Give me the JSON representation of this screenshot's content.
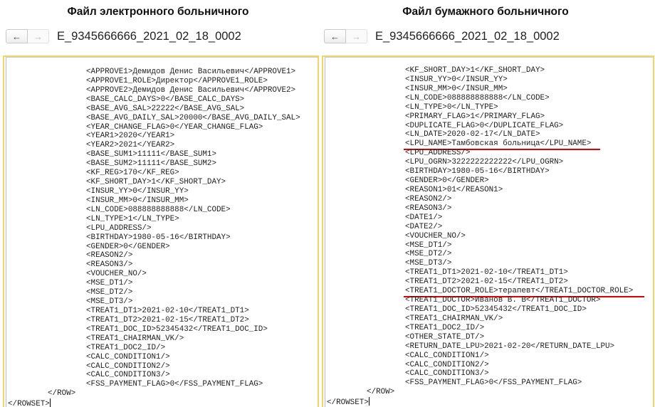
{
  "left": {
    "title": "Файл электронного больничного",
    "filename": "E_9345666666_2021_02_18_0002",
    "lines": [
      "<APPROVE1>Демидов Денис Васильевич</APPROVE1>",
      "<APPROVE1_ROLE>Директор</APPROVE1_ROLE>",
      "<APPROVE2>Демидов Денис Васильевич</APPROVE2>",
      "<BASE_CALC_DAYS>0</BASE_CALC_DAYS>",
      "<BASE_AVG_SAL>22222</BASE_AVG_SAL>",
      "<BASE_AVG_DAILY_SAL>20000</BASE_AVG_DAILY_SAL>",
      "<YEAR_CHANGE_FLAG>0</YEAR_CHANGE_FLAG>",
      "<YEAR1>2020</YEAR1>",
      "<YEAR2>2021</YEAR2>",
      "<BASE_SUM1>11111</BASE_SUM1>",
      "<BASE_SUM2>11111</BASE_SUM2>",
      "<KF_REG>170</KF_REG>",
      "<KF_SHORT_DAY>1</KF_SHORT_DAY>",
      "<INSUR_YY>0</INSUR_YY>",
      "<INSUR_MM>0</INSUR_MM>",
      "<LN_CODE>088888888888</LN_CODE>",
      "<LN_TYPE>1</LN_TYPE>",
      "<LPU_ADDRESS/>",
      "<BIRTHDAY>1980-05-16</BIRTHDAY>",
      "<GENDER>0</GENDER>",
      "<REASON2/>",
      "<REASON3/>",
      "<VOUCHER_NO/>",
      "<MSE_DT1/>",
      "<MSE_DT2/>",
      "<MSE_DT3/>",
      "<TREAT1_DT1>2021-02-10</TREAT1_DT1>",
      "<TREAT1_DT2>2021-02-15</TREAT1_DT2>",
      "<TREAT1_DOC_ID>52345432</TREAT1_DOC_ID>",
      "<TREAT1_CHAIRMAN_VK/>",
      "<TREAT1_DOC2_ID/>",
      "<CALC_CONDITION1/>",
      "<CALC_CONDITION2/>",
      "<CALC_CONDITION3/>",
      "<FSS_PAYMENT_FLAG>0</FSS_PAYMENT_FLAG>"
    ],
    "row_close": "</ROW>",
    "rowset_close": "</ROWSET>"
  },
  "right": {
    "title": "Файл бумажного больничного",
    "filename": "E_9345666666_2021_02_18_0002",
    "lines": [
      "<KF_SHORT_DAY>1</KF_SHORT_DAY>",
      "<INSUR_YY>0</INSUR_YY>",
      "<INSUR_MM>0</INSUR_MM>",
      "<LN_CODE>088888888888</LN_CODE>",
      "<LN_TYPE>0</LN_TYPE>",
      "<PRIMARY_FLAG>1</PRIMARY_FLAG>",
      "<DUPLICATE_FLAG>0</DUPLICATE_FLAG>",
      "<LN_DATE>2020-02-17</LN_DATE>",
      "<LPU_NAME>Тамбовская больница</LPU_NAME>",
      "<LPU_ADDRESS/>",
      "<LPU_OGRN>3222222222222</LPU_OGRN>",
      "<BIRTHDAY>1980-05-16</BIRTHDAY>",
      "<GENDER>0</GENDER>",
      "<REASON1>01</REASON1>",
      "<REASON2/>",
      "<REASON3/>",
      "<DATE1/>",
      "<DATE2/>",
      "<VOUCHER_NO/>",
      "<MSE_DT1/>",
      "<MSE_DT2/>",
      "<MSE_DT3/>",
      "<TREAT1_DT1>2021-02-10</TREAT1_DT1>",
      "<TREAT1_DT2>2021-02-15</TREAT1_DT2>",
      "<TREAT1_DOCTOR_ROLE>терапевт</TREAT1_DOCTOR_ROLE>",
      "<TREAT1_DOCTOR>Иванов В. В</TREAT1_DOCTOR>",
      "<TREAT1_DOC_ID>52345432</TREAT1_DOC_ID>",
      "<TREAT1_CHAIRMAN_VK/>",
      "<TREAT1_DOC2_ID/>",
      "<OTHER_STATE_DT/>",
      "<RETURN_DATE_LPU>2021-02-20</RETURN_DATE_LPU>",
      "<CALC_CONDITION1/>",
      "<CALC_CONDITION2/>",
      "<CALC_CONDITION3/>",
      "<FSS_PAYMENT_FLAG>0</FSS_PAYMENT_FLAG>"
    ],
    "row_close": "</ROW>",
    "rowset_close": "</ROWSET>",
    "highlighted_lines": [
      8,
      24
    ]
  },
  "nav": {
    "back_icon": "←",
    "forward_icon": "→"
  },
  "colors": {
    "panel_border": "#f3d36a",
    "highlight": "#e00000"
  }
}
